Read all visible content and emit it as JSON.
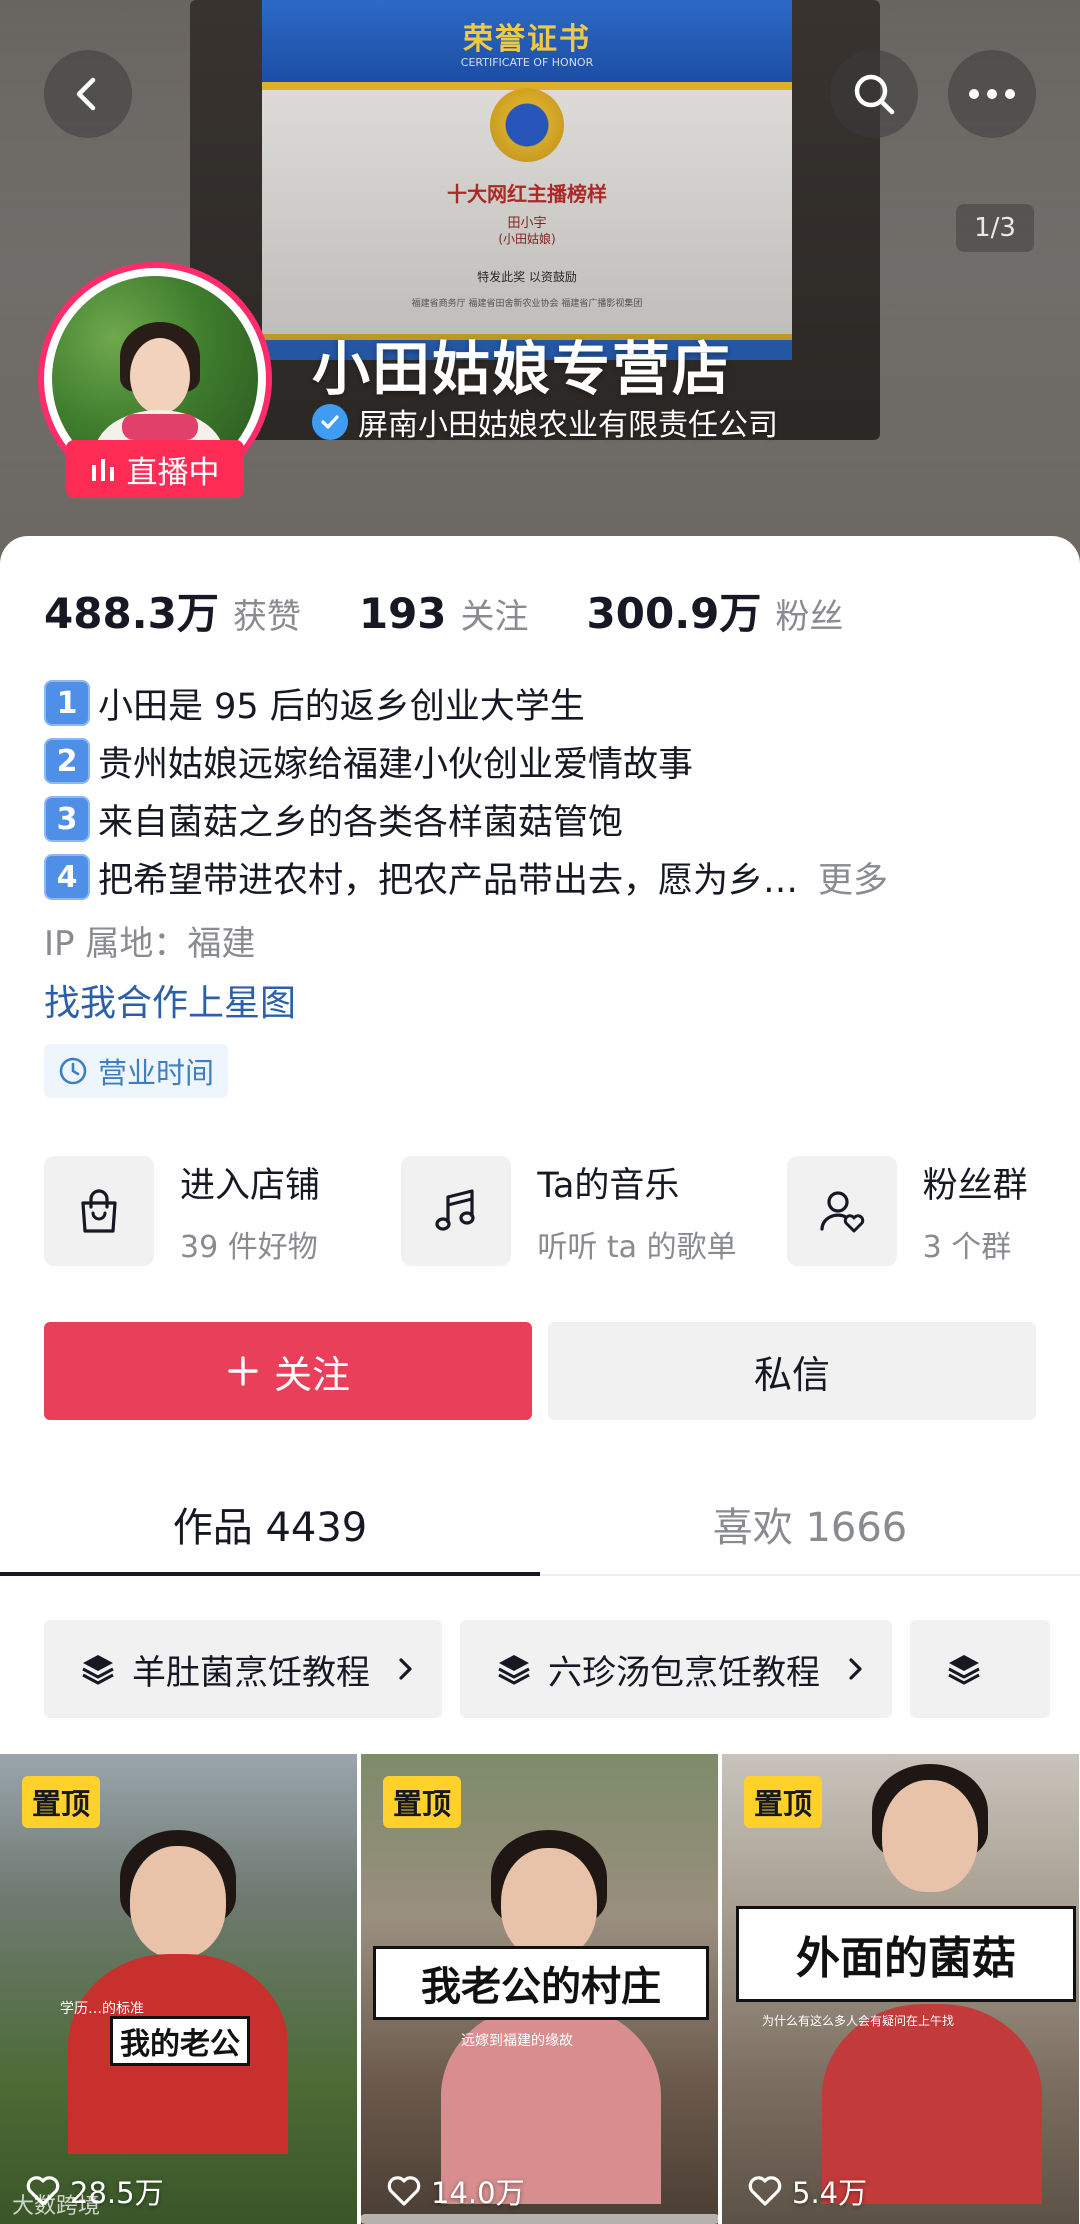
{
  "banner": {
    "certificate": {
      "title": "荣誉证书",
      "subtitle": "CERTIFICATE OF HONOR",
      "award": "十大网红主播榜样",
      "recipient": "田小宇",
      "recipient_alias": "(小田姑娘)",
      "note": "特发此奖 以资鼓励",
      "issuers": "福建省商务厅   福建省田舍新农业协会   福建省广播影视集团"
    },
    "page_indicator": "1/3"
  },
  "profile": {
    "shop_name": "小田姑娘专营店",
    "company": "屏南小田姑娘农业有限责任公司",
    "live_label": "直播中"
  },
  "stats": [
    {
      "value": "488.3万",
      "label": "获赞"
    },
    {
      "value": "193",
      "label": "关注"
    },
    {
      "value": "300.9万",
      "label": "粉丝"
    }
  ],
  "bio": [
    {
      "num": "1",
      "text": "小田是 95 后的返乡创业大学生"
    },
    {
      "num": "2",
      "text": "贵州姑娘远嫁给福建小伙创业爱情故事"
    },
    {
      "num": "3",
      "text": "来自菌菇之乡的各类各样菌菇管饱"
    },
    {
      "num": "4",
      "text": "把希望带进农村，把农产品带出去，愿为乡…"
    }
  ],
  "bio_more": "更多",
  "ip_location": "IP 属地：福建",
  "star_link": "找我合作上星图",
  "business_hours": "营业时间",
  "entries": [
    {
      "title": "进入店铺",
      "sub": "39 件好物",
      "icon": "shopping-bag-icon"
    },
    {
      "title": "Ta的音乐",
      "sub": "听听 ta 的歌单",
      "icon": "music-note-icon"
    },
    {
      "title": "粉丝群",
      "sub": "3 个群",
      "icon": "fan-group-icon"
    }
  ],
  "actions": {
    "follow": "关注",
    "message": "私信"
  },
  "tabs": [
    {
      "label": "作品 4439",
      "active": true
    },
    {
      "label": "喜欢 1666",
      "active": false
    }
  ],
  "collections": [
    {
      "label": "羊肚菌烹饪教程"
    },
    {
      "label": "六珍汤包烹饪教程"
    }
  ],
  "videos": [
    {
      "pinned": "置顶",
      "caption": "我的老公",
      "sub": "学历…的标准",
      "likes": "28.5万"
    },
    {
      "pinned": "置顶",
      "caption": "我老公的村庄",
      "sub": "远嫁到福建的缘故",
      "likes": "14.0万"
    },
    {
      "pinned": "置顶",
      "caption": "外面的菌菇",
      "sub": "为什么有这么多人会有疑问在上午找",
      "likes": "5.4万"
    }
  ],
  "watermark": "大数跨境",
  "colors": {
    "accent": "#fe2c55",
    "follow_button": "#ea3f5a",
    "link": "#2b5fa8",
    "verified": "#3e9cf2",
    "pin_badge": "#ffd12a"
  }
}
